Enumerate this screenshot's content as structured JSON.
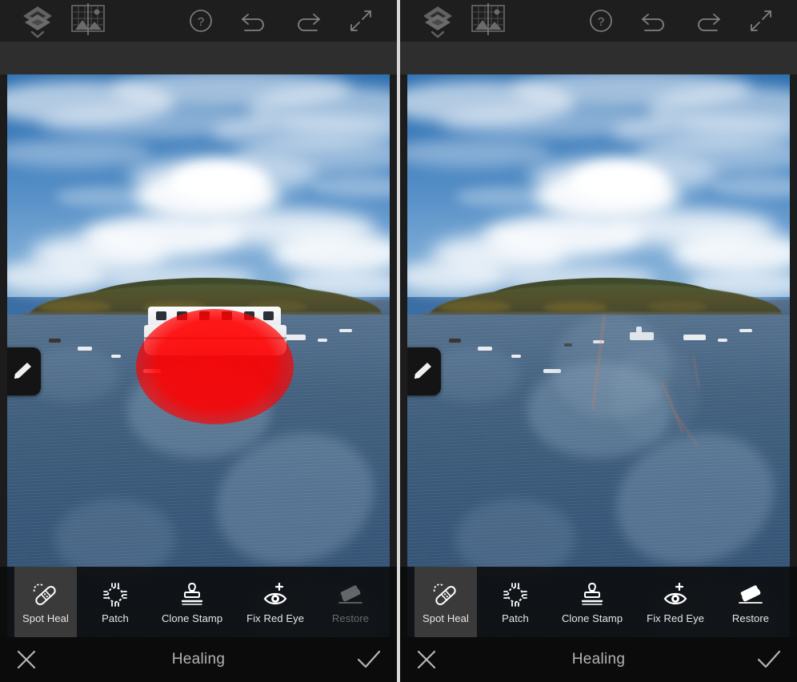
{
  "app": {
    "panel_count": 2,
    "mode_title": "Healing"
  },
  "header": {
    "left_icons": [
      {
        "name": "layers-icon",
        "label": "Layers"
      },
      {
        "name": "image-grid-icon",
        "label": "Image"
      }
    ],
    "right_icons": [
      {
        "name": "help-icon",
        "label": "Help"
      },
      {
        "name": "undo-icon",
        "label": "Undo"
      },
      {
        "name": "redo-icon",
        "label": "Redo"
      },
      {
        "name": "expand-icon",
        "label": "Fullscreen"
      }
    ]
  },
  "canvas": {
    "brush_tab_label": "Brush",
    "left_state": "masked",
    "right_state": "healed",
    "mask_color": "#ff0000"
  },
  "tools": {
    "left": [
      {
        "label": "Spot Heal",
        "icon": "bandage-icon",
        "active": true,
        "enabled": true
      },
      {
        "label": "Patch",
        "icon": "patch-icon",
        "active": false,
        "enabled": true
      },
      {
        "label": "Clone Stamp",
        "icon": "clone-stamp-icon",
        "active": false,
        "enabled": true
      },
      {
        "label": "Fix Red Eye",
        "icon": "red-eye-icon",
        "active": false,
        "enabled": true
      },
      {
        "label": "Restore",
        "icon": "eraser-icon",
        "active": false,
        "enabled": false
      }
    ],
    "right": [
      {
        "label": "Spot Heal",
        "icon": "bandage-icon",
        "active": true,
        "enabled": true
      },
      {
        "label": "Patch",
        "icon": "patch-icon",
        "active": false,
        "enabled": true
      },
      {
        "label": "Clone Stamp",
        "icon": "clone-stamp-icon",
        "active": false,
        "enabled": true
      },
      {
        "label": "Fix Red Eye",
        "icon": "red-eye-icon",
        "active": false,
        "enabled": true
      },
      {
        "label": "Restore",
        "icon": "eraser-icon",
        "active": false,
        "enabled": true
      }
    ]
  },
  "bottom_bar": {
    "cancel_label": "Cancel",
    "title": "Healing",
    "confirm_label": "Done"
  },
  "colors": {
    "header_bg": "#1e1e1e",
    "sub_band_bg": "#2e2e2e",
    "tool_active_bg": "#3a3a3a",
    "bottom_bar_bg": "#0b0b0b",
    "divider": "#d8d8d8",
    "label_text": "#e8e8e8",
    "disabled_text": "#6b6b6b",
    "title_text": "#b4b4b4"
  }
}
